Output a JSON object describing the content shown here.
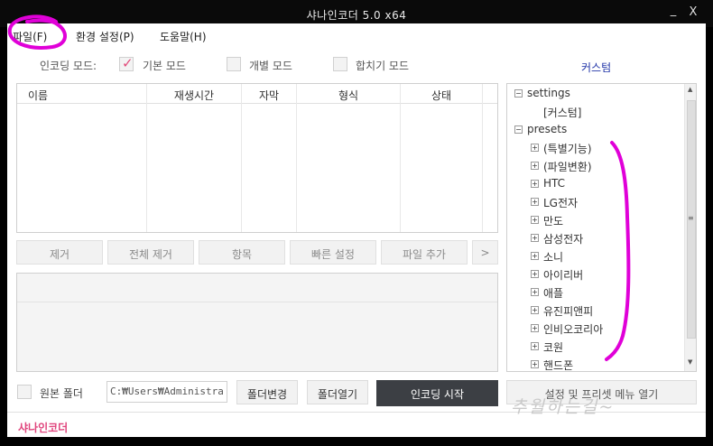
{
  "window": {
    "title": "샤나인코더  5.0  x64",
    "minimize_glyph": "_",
    "close_glyph": "X"
  },
  "menu": {
    "items": [
      "파일(F)",
      "환경 설정(P)",
      "도움말(H)"
    ]
  },
  "encoding_mode": {
    "label": "인코딩 모드:",
    "options": [
      {
        "label": "기본 모드",
        "checked": true
      },
      {
        "label": "개별 모드",
        "checked": false
      },
      {
        "label": "합치기 모드",
        "checked": false
      }
    ],
    "check_glyph": "✓"
  },
  "custom_link": "커스텀",
  "file_table": {
    "columns": [
      "이름",
      "재생시간",
      "자막",
      "형식",
      "상태"
    ],
    "rows": []
  },
  "actions": {
    "remove": "제거",
    "remove_all": "전체 제거",
    "item": "항목",
    "quick_settings": "빠른 설정",
    "add_file": "파일 추가",
    "more": ">"
  },
  "preset_tree": {
    "settings": {
      "label": "settings",
      "children": [
        "[커스텀]"
      ]
    },
    "presets": {
      "label": "presets",
      "children": [
        "(특별기능)",
        "(파일변환)",
        "HTC",
        "LG전자",
        "만도",
        "삼성전자",
        "소니",
        "아이리버",
        "애플",
        "유진피앤피",
        "인비오코리아",
        "코원",
        "핸드폰"
      ]
    },
    "collapse_glyph": "−",
    "expand_glyph": "+"
  },
  "output": {
    "source_folder_label": "원본 폴더",
    "source_folder_checked": false,
    "path_value": "C:₩Users₩Administra",
    "change_folder": "폴더변경",
    "open_folder": "폴더열기",
    "start_encoding": "인코딩 시작",
    "settings_menu_open": "설정 및 프리셋 메뉴 열기"
  },
  "status": {
    "brand": "샤나인코더"
  },
  "watermark": "추월하는길~",
  "colors": {
    "accent_pink": "#e0457d",
    "link_blue": "#2336a8",
    "start_button": "#3c3f44",
    "annotation_magenta": "#e000d8"
  }
}
